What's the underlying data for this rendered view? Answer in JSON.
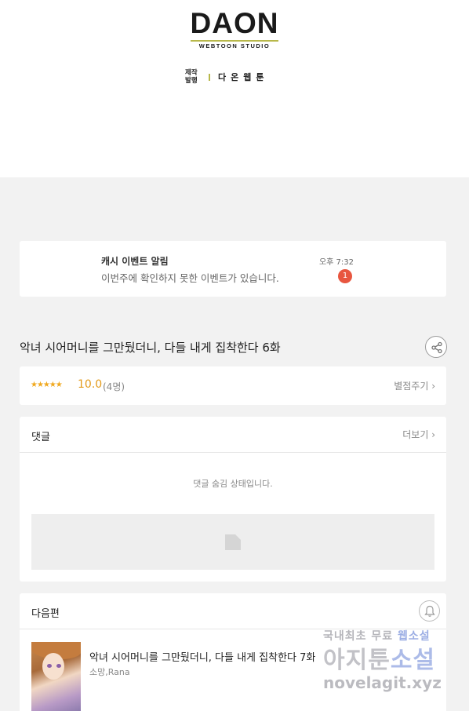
{
  "header": {
    "logo_main": "DAON",
    "logo_sub": "WEBTOON STUDIO",
    "credit_role": "제작 발행",
    "credit_name": "다온웹툰"
  },
  "notice": {
    "title": "캐시 이벤트 알림",
    "time": "오후 7:32",
    "body": "이번주에 확인하지 못한 이벤트가 있습니다.",
    "badge_count": "1"
  },
  "episode": {
    "title": "악녀 시어머니를 그만뒀더니, 다들 내게 집착한다 6화"
  },
  "rating": {
    "stars": "★★★★★",
    "score": "10.0",
    "count": "(4명)",
    "rate_link": "별점주기 ›"
  },
  "comments": {
    "title": "댓글",
    "more_link": "더보기 ›",
    "hidden_message": "댓글 숨김 상태입니다."
  },
  "next": {
    "title": "다음편",
    "episode_title": "악녀 시어머니를 그만뒀더니, 다들 내게 집착한다 7화",
    "author": "소망,Rana"
  },
  "watermark": {
    "line1_a": "국내최초 무료 ",
    "line1_b": "웹소설",
    "line2_a": "아지툰",
    "line2_b": "소설",
    "line3": "novelagit.xyz"
  },
  "colors": {
    "accent_star": "#f0a81e",
    "badge": "#e8563f",
    "logo_line": "#b8b84a"
  },
  "icons": [
    "share-icon",
    "bell-icon",
    "image-placeholder-icon"
  ]
}
